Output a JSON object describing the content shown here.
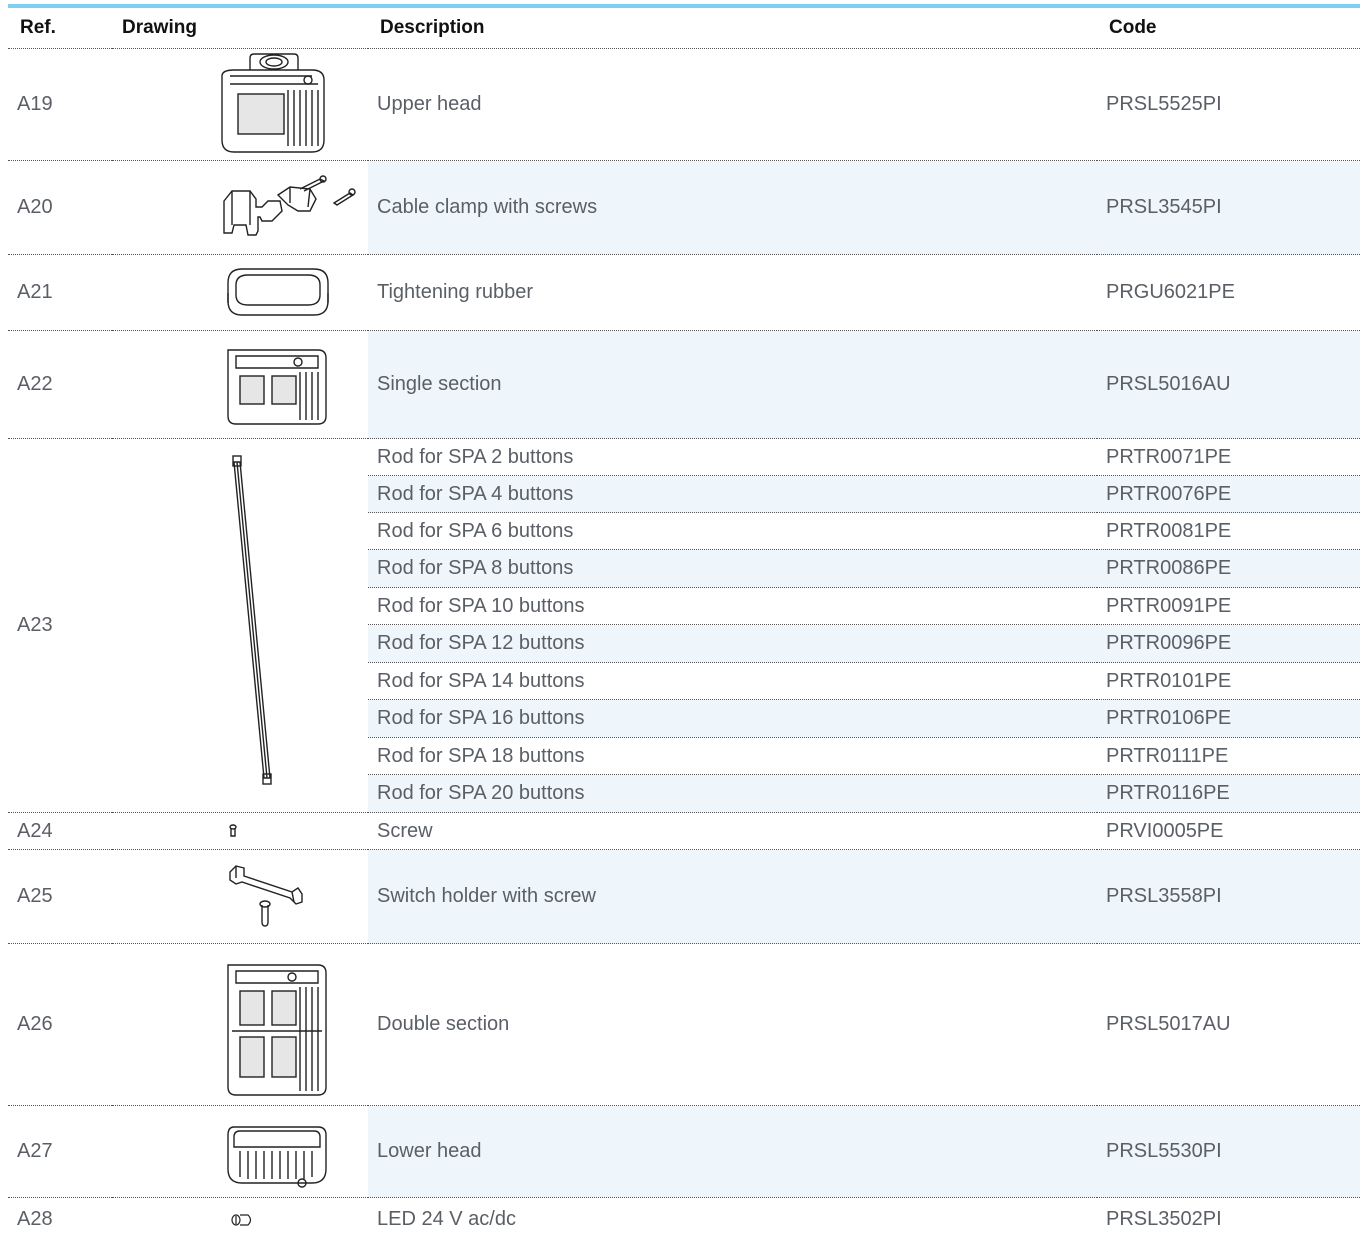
{
  "headers": {
    "ref": "Ref.",
    "drawing": "Drawing",
    "description": "Description",
    "code": "Code"
  },
  "rows": [
    {
      "ref": "A19",
      "icon": "upper-head-drawing",
      "items": [
        {
          "desc": "Upper head",
          "code": "PRSL5525PI"
        }
      ]
    },
    {
      "ref": "A20",
      "icon": "cable-clamp-drawing",
      "items": [
        {
          "desc": "Cable clamp with screws",
          "code": "PRSL3545PI"
        }
      ]
    },
    {
      "ref": "A21",
      "icon": "tightening-rubber-drawing",
      "items": [
        {
          "desc": "Tightening rubber",
          "code": "PRGU6021PE"
        }
      ]
    },
    {
      "ref": "A22",
      "icon": "single-section-drawing",
      "items": [
        {
          "desc": "Single section",
          "code": "PRSL5016AU"
        }
      ]
    },
    {
      "ref": "A23",
      "icon": "rod-drawing",
      "items": [
        {
          "desc": "Rod for SPA 2 buttons",
          "code": "PRTR0071PE"
        },
        {
          "desc": "Rod for SPA 4 buttons",
          "code": "PRTR0076PE"
        },
        {
          "desc": "Rod for SPA 6 buttons",
          "code": "PRTR0081PE"
        },
        {
          "desc": "Rod for SPA 8 buttons",
          "code": "PRTR0086PE"
        },
        {
          "desc": "Rod for SPA 10 buttons",
          "code": "PRTR0091PE"
        },
        {
          "desc": "Rod for SPA 12 buttons",
          "code": "PRTR0096PE"
        },
        {
          "desc": "Rod for SPA 14 buttons",
          "code": "PRTR0101PE"
        },
        {
          "desc": "Rod for SPA 16 buttons",
          "code": "PRTR0106PE"
        },
        {
          "desc": "Rod for SPA 18 buttons",
          "code": "PRTR0111PE"
        },
        {
          "desc": "Rod for SPA 20 buttons",
          "code": "PRTR0116PE"
        }
      ]
    },
    {
      "ref": "A24",
      "icon": "screw-drawing",
      "items": [
        {
          "desc": "Screw",
          "code": "PRVI0005PE"
        }
      ]
    },
    {
      "ref": "A25",
      "icon": "switch-holder-drawing",
      "items": [
        {
          "desc": "Switch holder with screw",
          "code": "PRSL3558PI"
        }
      ]
    },
    {
      "ref": "A26",
      "icon": "double-section-drawing",
      "items": [
        {
          "desc": "Double section",
          "code": "PRSL5017AU"
        }
      ]
    },
    {
      "ref": "A27",
      "icon": "lower-head-drawing",
      "items": [
        {
          "desc": "Lower head",
          "code": "PRSL5530PI"
        }
      ]
    },
    {
      "ref": "A28",
      "icon": "led-drawing",
      "items": [
        {
          "desc": "LED 24 V ac/dc",
          "code": "PRSL3502PI"
        }
      ]
    }
  ],
  "colors": {
    "accent": "#7fcff0",
    "shade": "#eef6fc",
    "text": "#5a5f66",
    "header": "#111111"
  }
}
